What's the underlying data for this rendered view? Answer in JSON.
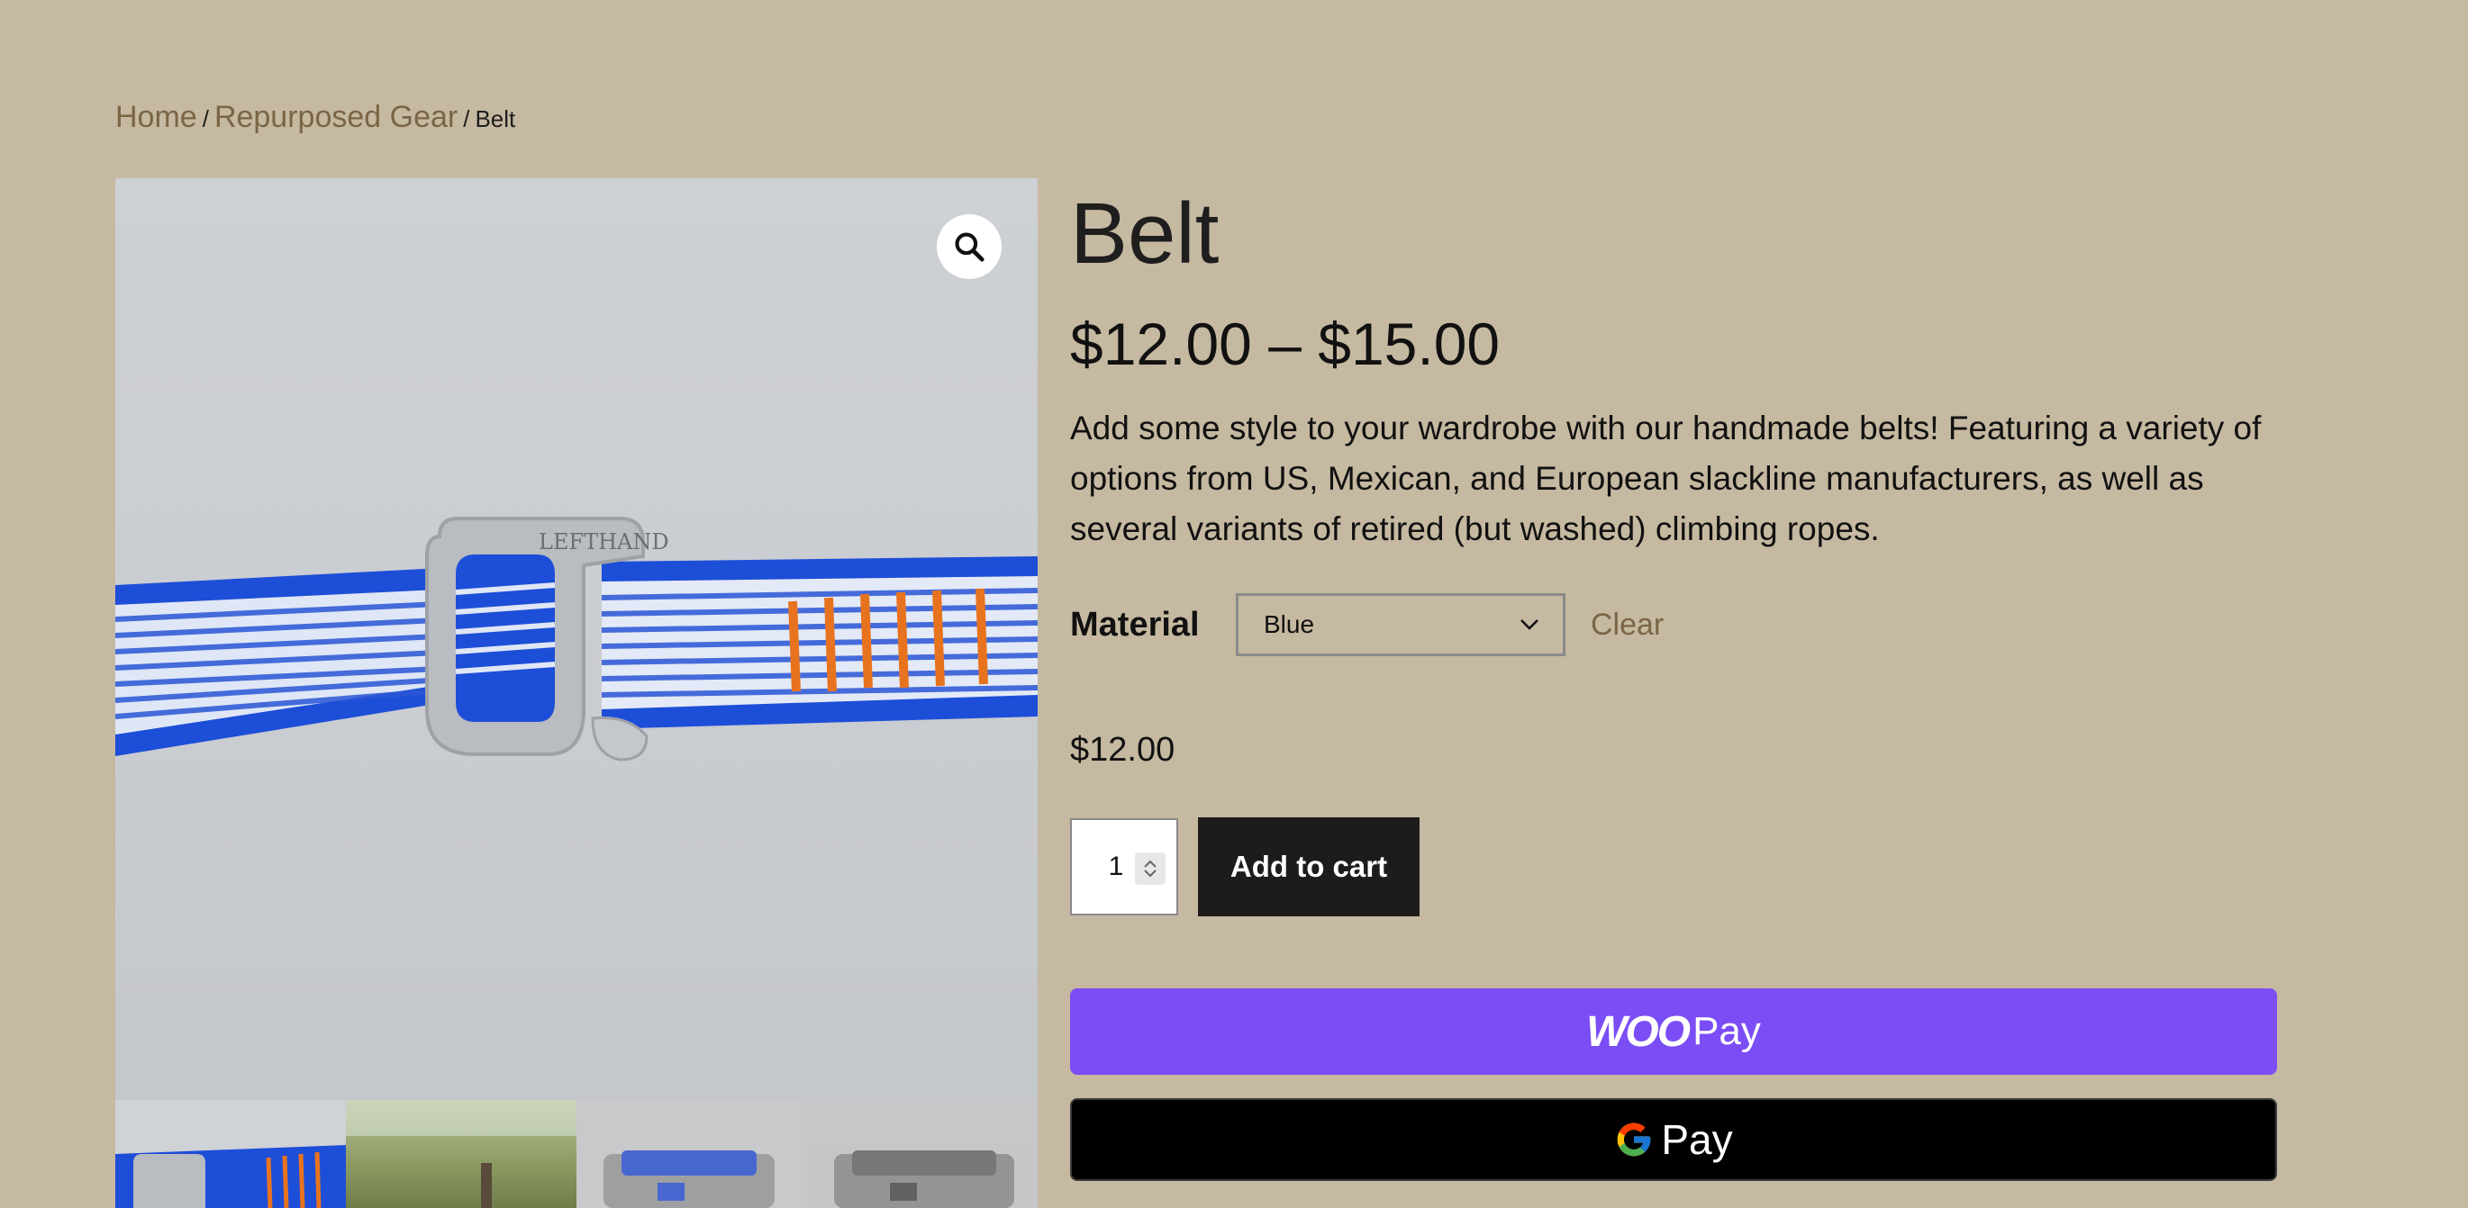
{
  "breadcrumb": {
    "home": "Home",
    "category": "Repurposed Gear",
    "separator": "/",
    "current": "Belt"
  },
  "gallery": {
    "zoom_icon": "magnifier-icon",
    "main_image_alt": "LEFTHAND",
    "thumbnails_count": 4
  },
  "product": {
    "title": "Belt",
    "price_range": "$12.00 – $15.00",
    "description": "Add some style to your wardrobe with our handmade belts! Featuring a variety of options from US, Mexican, and European slackline manufacturers, as well as several variants of retired (but washed) climbing ropes."
  },
  "variation": {
    "label": "Material",
    "selected": "Blue",
    "clear_label": "Clear",
    "price": "$12.00"
  },
  "cart": {
    "quantity": "1",
    "add_label": "Add to cart"
  },
  "payments": {
    "woopay_woo": "WOO",
    "woopay_pay": "Pay",
    "gpay_pay": "Pay"
  },
  "colors": {
    "background": "#c6b9a1",
    "link": "#7b6547",
    "woopay": "#7b4df5",
    "cart_button": "#1e1c1b"
  }
}
